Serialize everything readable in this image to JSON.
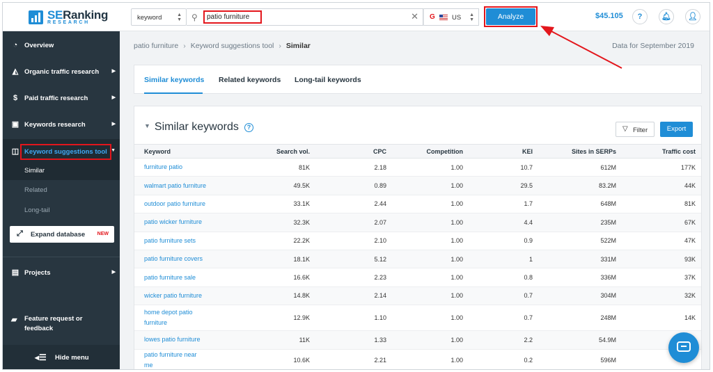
{
  "logo": {
    "brand_se": "SE",
    "brand_rest": "Ranking",
    "sub": "RESEARCH"
  },
  "sidebar": {
    "items": [
      {
        "label": "Overview"
      },
      {
        "label": "Organic traffic research"
      },
      {
        "label": "Paid traffic research"
      },
      {
        "label": "Keywords research"
      },
      {
        "label": "Keyword suggestions tool"
      }
    ],
    "subitems": [
      {
        "label": "Similar"
      },
      {
        "label": "Related"
      },
      {
        "label": "Long-tail"
      }
    ],
    "expand_label": "Expand database",
    "expand_badge": "NEW",
    "projects_label": "Projects",
    "feature_label": "Feature request or feedback",
    "hide_label": "Hide menu"
  },
  "topbar": {
    "type_value": "keyword",
    "search_value": "patio furniture",
    "location_value": "US",
    "location_engine": "G",
    "analyze_label": "Analyze",
    "balance": "$45.105",
    "help_label": "?"
  },
  "breadcrumb": {
    "items": [
      "patio furniture",
      "Keyword suggestions tool",
      "Similar"
    ],
    "data_for": "Data for September 2019"
  },
  "tabs": [
    "Similar keywords",
    "Related keywords",
    "Long-tail keywords"
  ],
  "section": {
    "title": "Similar keywords",
    "filter_label": "Filter",
    "export_label": "Export"
  },
  "table": {
    "columns": [
      "Keyword",
      "Search vol.",
      "CPC",
      "Competition",
      "KEI",
      "Sites in SERPs",
      "Traffic cost"
    ],
    "rows": [
      [
        "furniture patio",
        "81K",
        "2.18",
        "1.00",
        "10.7",
        "612M",
        "177K"
      ],
      [
        "walmart patio furniture",
        "49.5K",
        "0.89",
        "1.00",
        "29.5",
        "83.2M",
        "44K"
      ],
      [
        "outdoor patio furniture",
        "33.1K",
        "2.44",
        "1.00",
        "1.7",
        "648M",
        "81K"
      ],
      [
        "patio wicker furniture",
        "32.3K",
        "2.07",
        "1.00",
        "4.4",
        "235M",
        "67K"
      ],
      [
        "patio furniture sets",
        "22.2K",
        "2.10",
        "1.00",
        "0.9",
        "522M",
        "47K"
      ],
      [
        "patio furniture covers",
        "18.1K",
        "5.12",
        "1.00",
        "1",
        "331M",
        "93K"
      ],
      [
        "patio furniture sale",
        "16.6K",
        "2.23",
        "1.00",
        "0.8",
        "336M",
        "37K"
      ],
      [
        "wicker patio furniture",
        "14.8K",
        "2.14",
        "1.00",
        "0.7",
        "304M",
        "32K"
      ],
      [
        "home depot patio furniture",
        "12.9K",
        "1.10",
        "1.00",
        "0.7",
        "248M",
        "14K"
      ],
      [
        "lowes patio furniture",
        "11K",
        "1.33",
        "1.00",
        "2.2",
        "54.9M",
        ""
      ],
      [
        "patio furniture near me",
        "10.6K",
        "2.21",
        "1.00",
        "0.2",
        "596M",
        ""
      ]
    ]
  },
  "colors": {
    "accent": "#1f8dd6",
    "sidebar": "#283640",
    "highlight": "#e3161c"
  }
}
